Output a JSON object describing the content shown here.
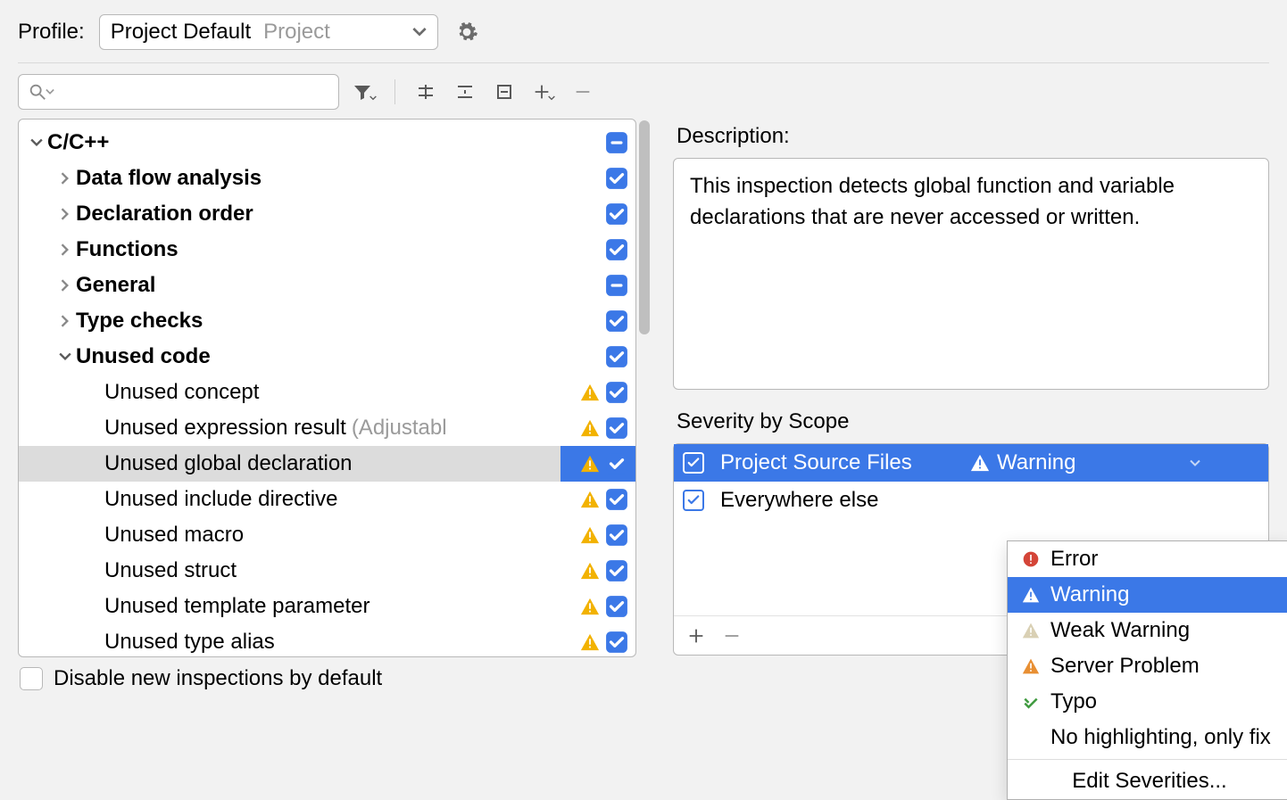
{
  "profile": {
    "label": "Profile:",
    "selected": "Project Default",
    "scope_suffix": "Project"
  },
  "search": {
    "placeholder": ""
  },
  "tree": {
    "root": "C/C++",
    "items": [
      {
        "label": "Data flow analysis",
        "bold": true,
        "arrow": "right",
        "check": "check",
        "indent": 1
      },
      {
        "label": "Declaration order",
        "bold": true,
        "arrow": "right",
        "check": "check",
        "indent": 1
      },
      {
        "label": "Functions",
        "bold": true,
        "arrow": "right",
        "check": "check",
        "indent": 1
      },
      {
        "label": "General",
        "bold": true,
        "arrow": "right",
        "check": "minus",
        "indent": 1
      },
      {
        "label": "Type checks",
        "bold": true,
        "arrow": "right",
        "check": "check",
        "indent": 1
      },
      {
        "label": "Unused code",
        "bold": true,
        "arrow": "down",
        "check": "check",
        "indent": 1
      },
      {
        "label": "Unused concept",
        "arrow": "",
        "check": "check",
        "warn": true,
        "indent": 2
      },
      {
        "label": "Unused expression result",
        "suffix": "(Adjustabl",
        "arrow": "",
        "check": "check",
        "warn": true,
        "indent": 2
      },
      {
        "label": "Unused global declaration",
        "arrow": "",
        "check": "check",
        "warn": true,
        "indent": 2,
        "selected": true
      },
      {
        "label": "Unused include directive",
        "arrow": "",
        "check": "check",
        "warn": true,
        "indent": 2
      },
      {
        "label": "Unused macro",
        "arrow": "",
        "check": "check",
        "warn": true,
        "indent": 2
      },
      {
        "label": "Unused struct",
        "arrow": "",
        "check": "check",
        "warn": true,
        "indent": 2
      },
      {
        "label": "Unused template parameter",
        "arrow": "",
        "check": "check",
        "warn": true,
        "indent": 2
      },
      {
        "label": "Unused type alias",
        "arrow": "",
        "check": "check",
        "warn": true,
        "indent": 2
      }
    ]
  },
  "description": {
    "label": "Description:",
    "text": "This inspection detects global function and variable declarations that are never accessed or written."
  },
  "severity": {
    "label": "Severity by Scope",
    "rows": [
      {
        "scope": "Project Source Files",
        "value": "Warning",
        "selected": true,
        "checked": true
      },
      {
        "scope": "Everywhere else",
        "value": "",
        "selected": false,
        "checked": true
      }
    ]
  },
  "dropdown": {
    "items": [
      {
        "label": "Error",
        "icon": "error"
      },
      {
        "label": "Warning",
        "icon": "warning",
        "selected": true
      },
      {
        "label": "Weak Warning",
        "icon": "weak"
      },
      {
        "label": "Server Problem",
        "icon": "server"
      },
      {
        "label": "Typo",
        "icon": "typo"
      },
      {
        "label": "No highlighting, only fix",
        "icon": ""
      }
    ],
    "edit": "Edit Severities..."
  },
  "footer": {
    "disable_label": "Disable new inspections by default"
  },
  "colors": {
    "accent": "#3b78e7",
    "warn_yellow": "#f2b200",
    "warn_orange": "#e88f33",
    "weak": "#d5cbad",
    "error": "#d44538",
    "typo": "#3f9a3f"
  }
}
